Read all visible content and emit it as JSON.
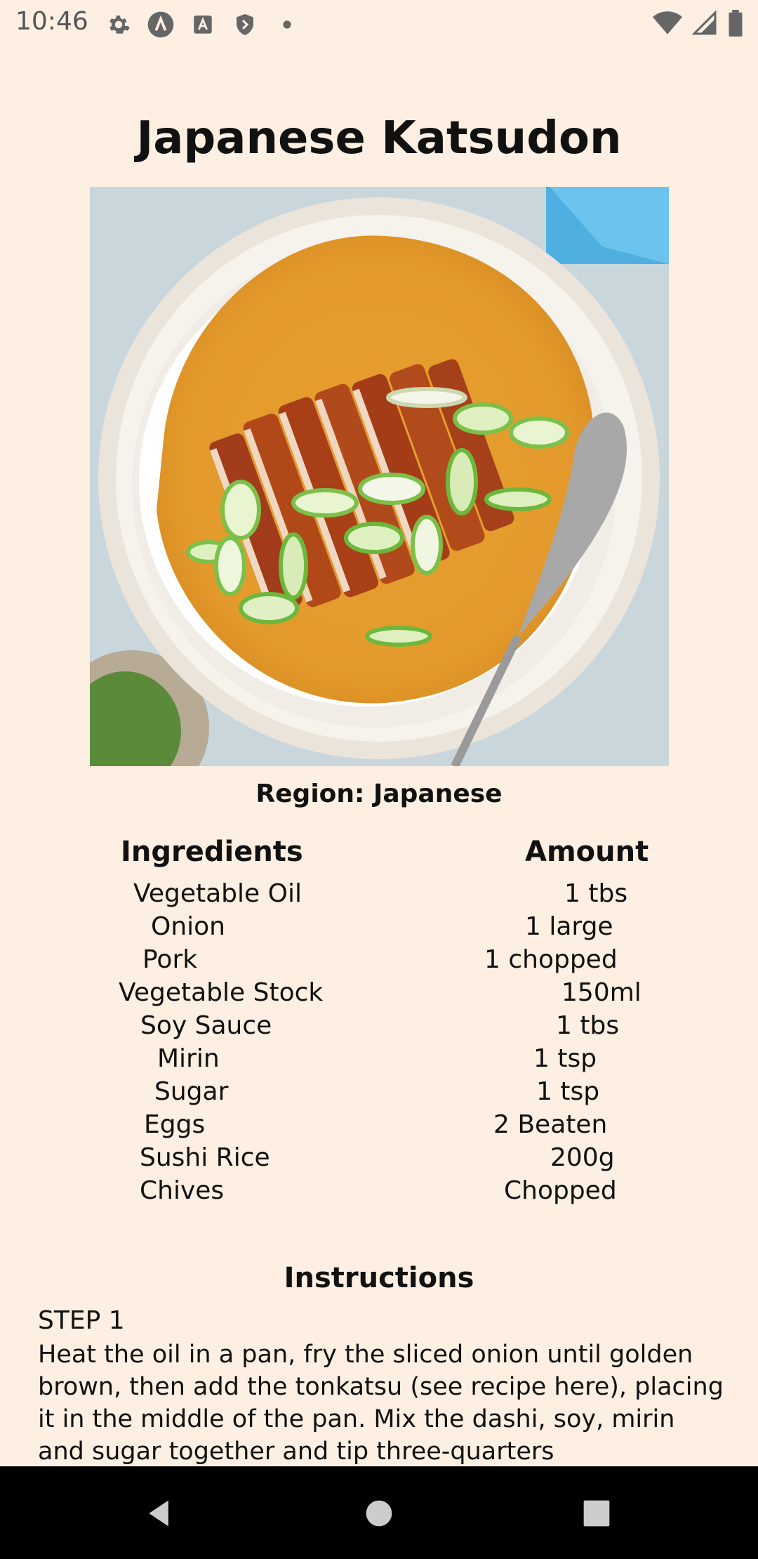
{
  "status_bar": {
    "time": "10:46",
    "left_icons": [
      "gear-icon",
      "app-a-icon",
      "font-a-icon",
      "shield-icon",
      "dot-icon"
    ],
    "right_icons": [
      "wifi-icon",
      "signal-icon",
      "battery-icon"
    ]
  },
  "recipe": {
    "title": "Japanese Katsudon",
    "image_alt": "katsudon-dish-image",
    "region": "Region: Japanese",
    "ingredients_header": "Ingredients",
    "amount_header": "Amount",
    "ingredients": [
      {
        "name": "Vegetable Oil",
        "amount": "1 tbs"
      },
      {
        "name": "Onion",
        "amount": "1 large"
      },
      {
        "name": "Pork",
        "amount": "1 chopped"
      },
      {
        "name": "Vegetable Stock",
        "amount": "150ml"
      },
      {
        "name": "Soy Sauce",
        "amount": "1 tbs"
      },
      {
        "name": "Mirin",
        "amount": "1 tsp"
      },
      {
        "name": "Sugar",
        "amount": "1 tsp"
      },
      {
        "name": "Eggs",
        "amount": "2 Beaten"
      },
      {
        "name": "Sushi Rice",
        "amount": "200g"
      },
      {
        "name": "Chives",
        "amount": "Chopped"
      }
    ],
    "instructions_title": "Instructions",
    "step_label": "STEP 1",
    "step_text": "Heat the oil in a pan, fry the sliced onion until golden brown, then add the tonkatsu (see recipe here), placing it in the middle of the pan. Mix the dashi, soy, mirin and sugar together and tip three-quarters"
  },
  "nav_bar": {
    "buttons": [
      "back-icon",
      "home-icon",
      "recents-icon"
    ]
  },
  "colors": {
    "background": "#fdefe1",
    "text": "#111111",
    "nav_bar": "#000000"
  }
}
